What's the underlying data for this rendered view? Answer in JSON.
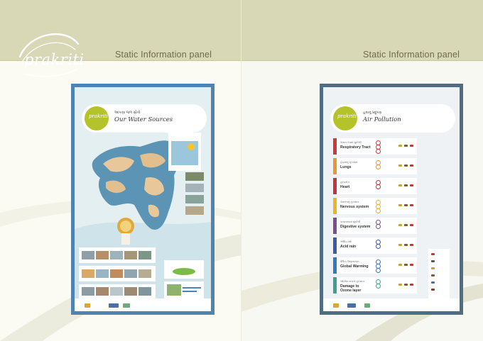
{
  "brand": {
    "logo_text": "prakriti"
  },
  "pages": [
    {
      "header": "Static Information panel"
    },
    {
      "header": "Static Information panel"
    }
  ],
  "water_poster": {
    "logo_text": "prakriti",
    "title_gujarati": "આપણા જળ સ્રોતો",
    "title": "Our Water Sources"
  },
  "air_poster": {
    "logo_text": "prakriti",
    "title_gujarati": "હવાનું પ્રદૂષણ",
    "title": "Air Pollution",
    "rows": [
      {
        "gu": "શ્વસન તંત્રમાં મુશ્કેલી",
        "en1": "Respiratory Tract",
        "en2": "",
        "color": "#d6343a"
      },
      {
        "gu": "ફેફસાંનું નુકસાન",
        "en1": "Lungs",
        "en2": "",
        "color": "#e7963a"
      },
      {
        "gu": "હૃદયરોગ",
        "en1": "Heart",
        "en2": "",
        "color": "#c8313f"
      },
      {
        "gu": "ચેતાતંત્રનું નુકસાન",
        "en1": "Nervous system",
        "en2": "",
        "color": "#e8b52a"
      },
      {
        "gu": "પાચનતંત્રમાં મુશ્કેલી",
        "en1": "Digestive system",
        "en2": "",
        "color": "#7b4e90"
      },
      {
        "gu": "એસિડ વર્ષા",
        "en1": "Acid rain",
        "en2": "",
        "color": "#3d5aa5"
      },
      {
        "gu": "વૈશ્વિક ઉષ્ણતામાન",
        "en1": "Global Warming",
        "en2": "",
        "color": "#2e7bbf"
      },
      {
        "gu": "ઓઝોન સ્તરને નુકસાન",
        "en1": "Damage to",
        "en2": "Ozone layer",
        "color": "#3aa38f"
      }
    ]
  },
  "colors": {
    "band": "#d8d7b6",
    "header_text": "#6e6b4c",
    "water_frame": "#4f84b2",
    "air_frame": "#4f6d83",
    "seal": "#b5c32a"
  }
}
